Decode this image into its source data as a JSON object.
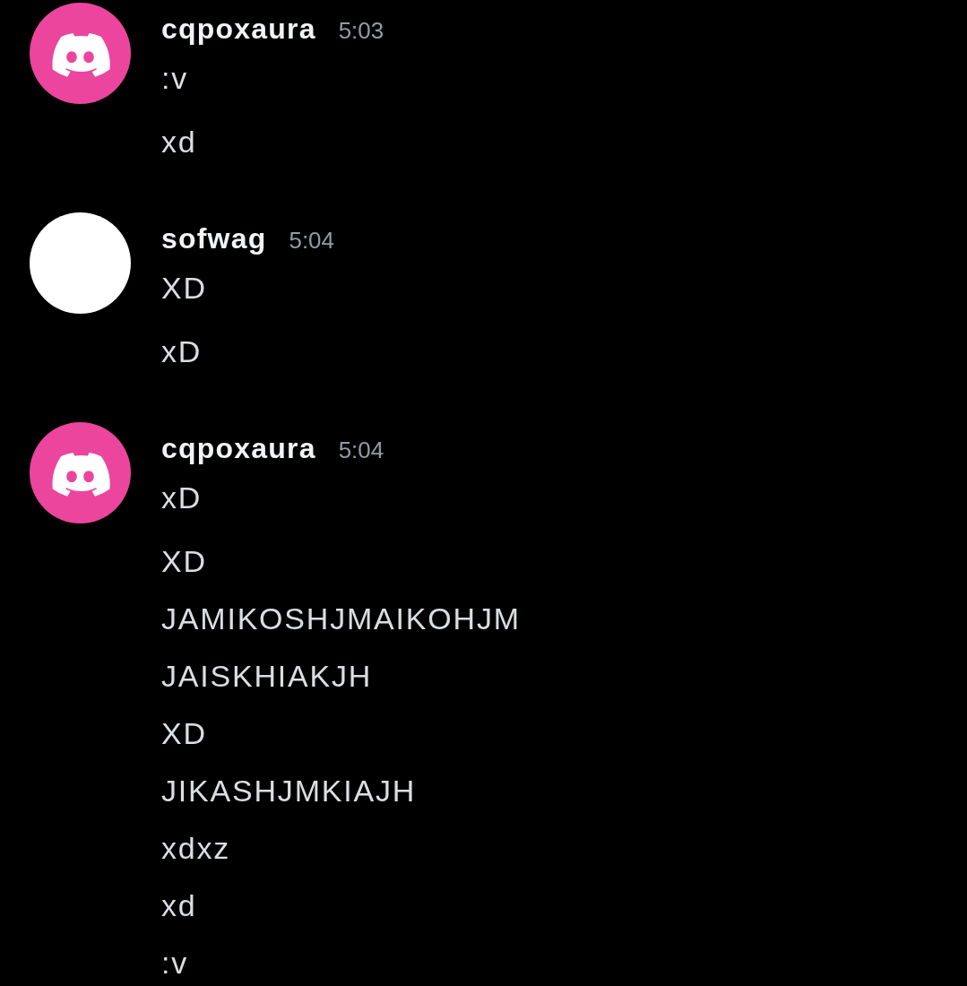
{
  "message_groups": [
    {
      "avatar": {
        "kind": "logo",
        "color": "#eb459e"
      },
      "author": "cqpoxaura",
      "timestamp": "5:03",
      "messages": [
        ":v",
        "xd"
      ]
    },
    {
      "avatar": {
        "kind": "plain",
        "color": "#ffffff"
      },
      "author": "sofwag",
      "timestamp": "5:04",
      "messages": [
        "XD",
        "xD"
      ]
    },
    {
      "avatar": {
        "kind": "logo",
        "color": "#eb459e"
      },
      "author": "cqpoxaura",
      "timestamp": "5:04",
      "messages": [
        "xD",
        "XD",
        "JAMIKOSHJMAIKOHJM",
        "JAISKHIAKJH",
        "XD",
        "JIKASHJMKIAJH",
        "xdxz",
        "xd",
        ":v"
      ]
    }
  ]
}
